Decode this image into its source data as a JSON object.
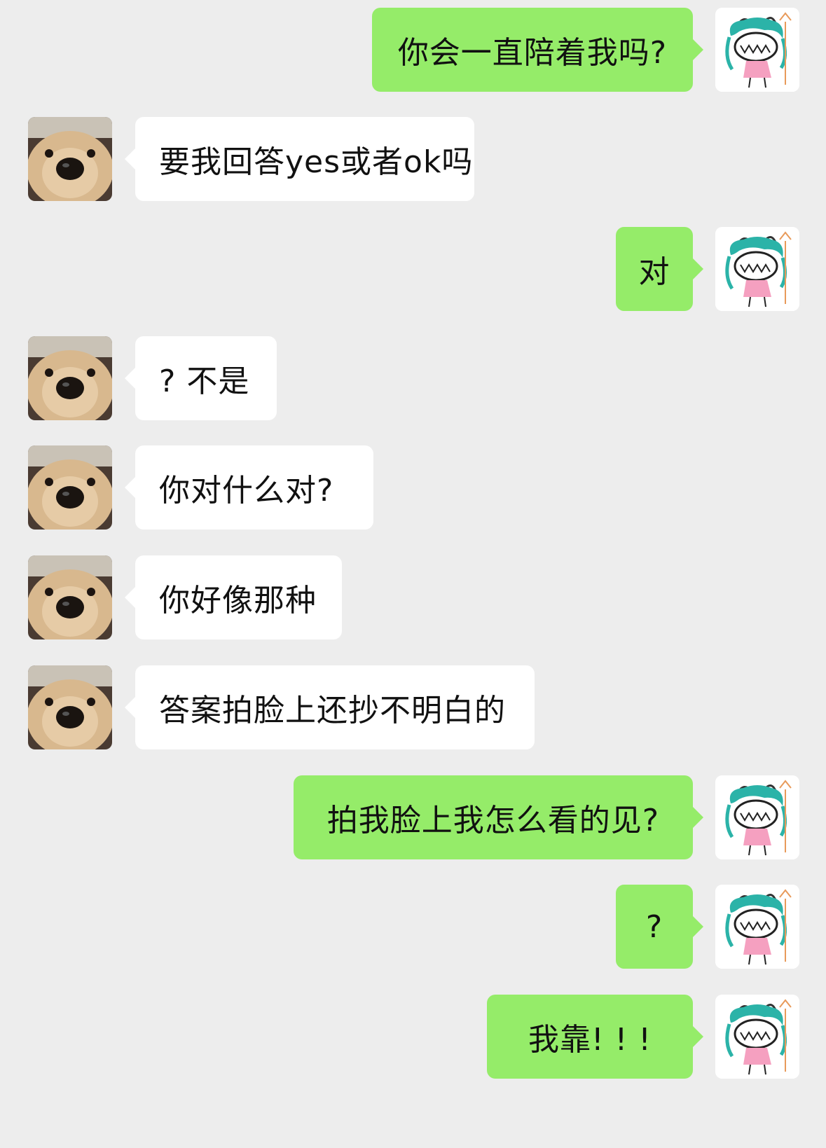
{
  "colors": {
    "background": "#ededed",
    "incoming_bubble": "#ffffff",
    "outgoing_bubble": "#95ec69",
    "text": "#111111"
  },
  "avatars": {
    "self": "anime-girl-doodle-avatar",
    "contact": "golden-puppy-face-avatar"
  },
  "messages": [
    {
      "side": "right",
      "text": "你会一直陪着我吗?"
    },
    {
      "side": "left",
      "text": "要我回答yes或者ok吗"
    },
    {
      "side": "right",
      "text": "对"
    },
    {
      "side": "left",
      "text": "? 不是"
    },
    {
      "side": "left",
      "text": "你对什么对?"
    },
    {
      "side": "left",
      "text": "你好像那种"
    },
    {
      "side": "left",
      "text": "答案拍脸上还抄不明白的"
    },
    {
      "side": "right",
      "text": "拍我脸上我怎么看的见?"
    },
    {
      "side": "right",
      "text": "?"
    },
    {
      "side": "right",
      "text": "我靠! ! !"
    }
  ]
}
